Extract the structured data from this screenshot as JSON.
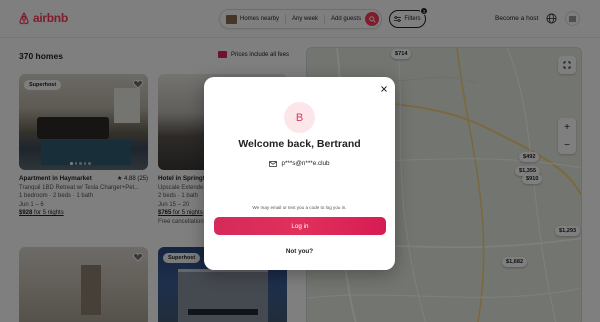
{
  "header": {
    "logo_text": "airbnb",
    "search": {
      "location": "Homes nearby",
      "dates": "Any week",
      "guests": "Add guests"
    },
    "filters_label": "Filters",
    "filters_count": "3",
    "host_label": "Become a host"
  },
  "listings": {
    "count_label": "370 homes",
    "prices_note": "Prices include all fees",
    "cards": [
      {
        "badge": "Superhost",
        "title": "Apartment in Haymarket",
        "rating": "★ 4.88 (25)",
        "description": "Tranquil 1BD Retreat w/ Tesla Charger+Pet...",
        "rooms": "1 bedroom · 2 beds · 1 bath",
        "dates": "Jun 1 – 6",
        "price": "$928",
        "price_suffix": " for 5 nights",
        "extra": ""
      },
      {
        "badge": "",
        "title": "Hotel in Springfi",
        "rating": "",
        "description": "Upscale Extende",
        "rooms": "2 beds · 1 bath",
        "dates": "Jun 15 – 20",
        "price": "$765",
        "price_suffix": " for 5 nights",
        "extra": "Free cancellation"
      },
      {
        "badge": ""
      },
      {
        "badge": "Superhost"
      }
    ]
  },
  "map": {
    "pins": [
      "$714",
      "$492",
      "$1,355",
      "$910",
      "$1,293",
      "$1,682"
    ]
  },
  "modal": {
    "avatar_letter": "B",
    "title": "Welcome back, Bertrand",
    "email": "p***s@n***e.club",
    "hint": "We may email or text you a code to log you in.",
    "login_label": "Log in",
    "not_you_label": "Not you?"
  },
  "colors": {
    "brand": "#ff385c",
    "login_button": "#dc2e5c"
  }
}
